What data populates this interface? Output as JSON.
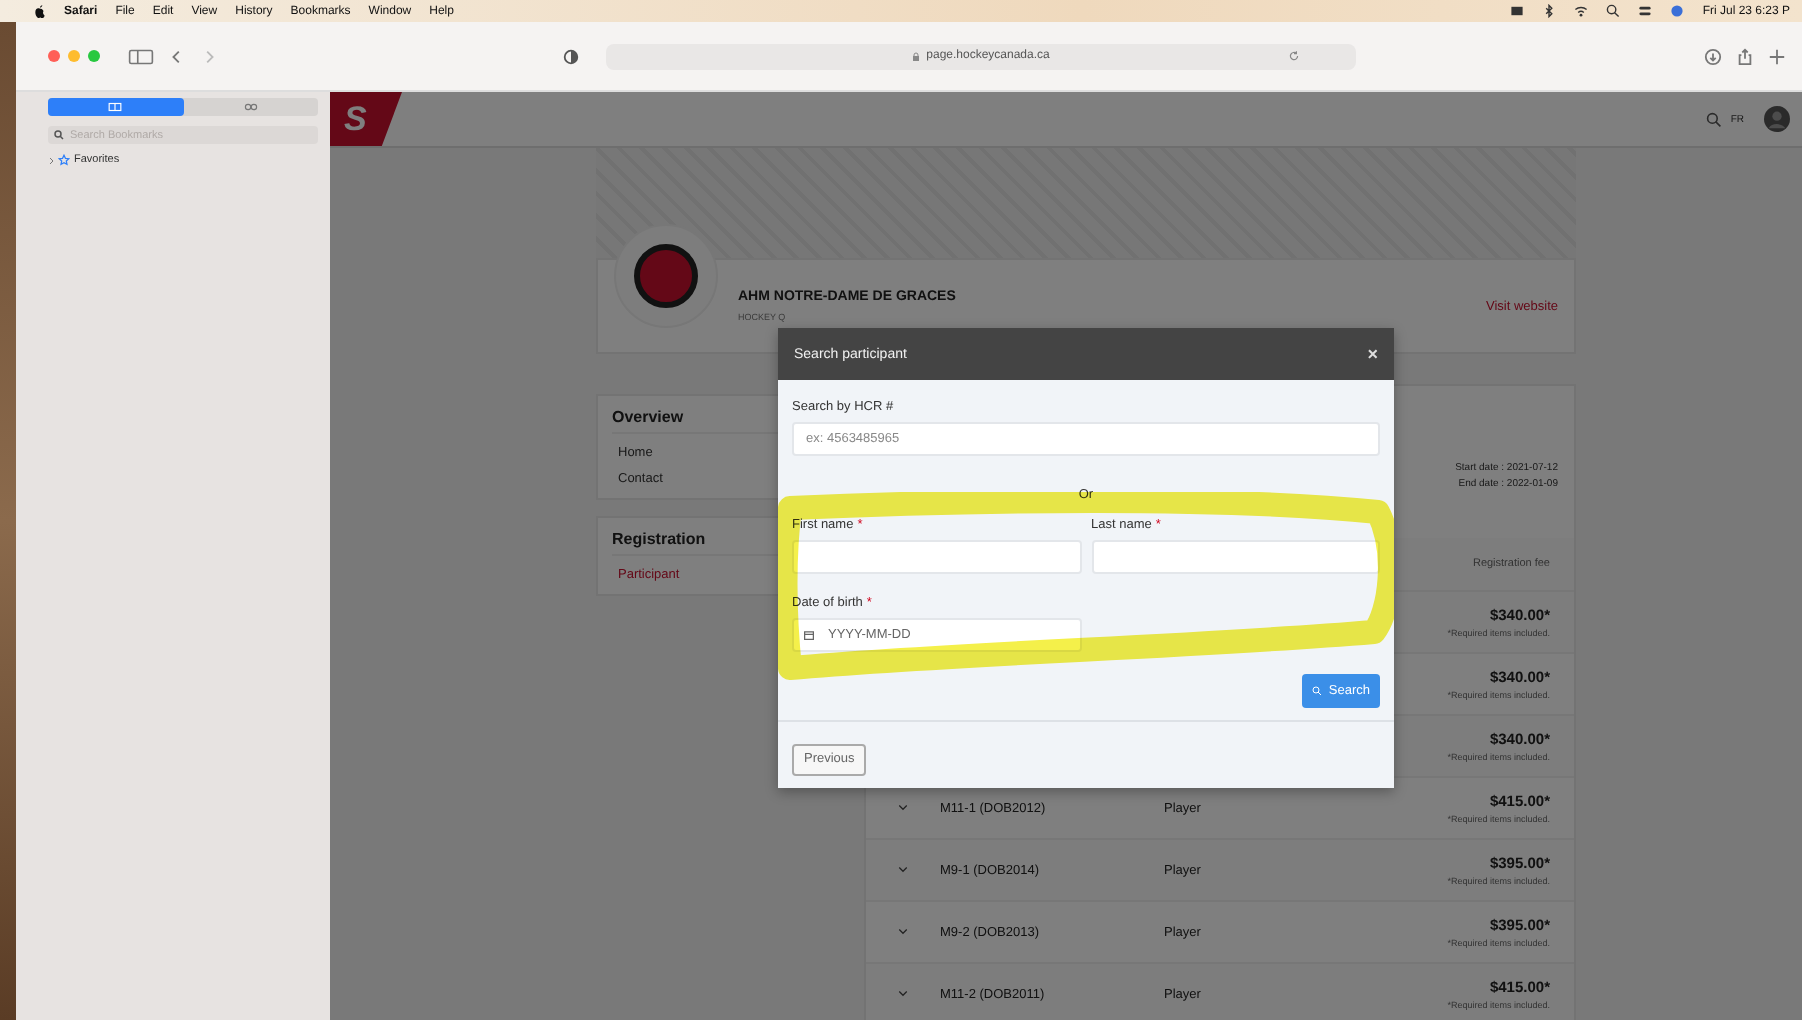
{
  "menu_bar": {
    "app": "Safari",
    "items": [
      "File",
      "Edit",
      "View",
      "History",
      "Bookmarks",
      "Window",
      "Help"
    ],
    "clock": "Fri Jul 23 6:23 P"
  },
  "browser": {
    "url": "page.hockeycanada.ca"
  },
  "sidebar": {
    "segments": [
      {
        "kind": "bookmarks",
        "selected": true
      },
      {
        "kind": "reading-list",
        "selected": false
      }
    ],
    "search": {
      "placeholder": "Search Bookmarks"
    },
    "items": [
      {
        "label": "Favorites",
        "expanded": false
      }
    ]
  },
  "site_header": {
    "logo": "S",
    "language": "FR"
  },
  "club": {
    "name": "AHM NOTRE-DAME DE GRACES",
    "federation": "HOCKEY Q",
    "link": "Visit website"
  },
  "nav_cards": [
    {
      "title": "Overview",
      "items": [
        {
          "label": "Home",
          "selected": false
        },
        {
          "label": "Contact",
          "selected": false
        }
      ]
    },
    {
      "title": "Registration",
      "items": [
        {
          "label": "Participant",
          "selected": true
        }
      ]
    }
  ],
  "season": {
    "start": "Start date : 2021-07-12",
    "end": "End date : 2022-01-09"
  },
  "table": {
    "fee_header": "Registration fee",
    "rows": [
      {
        "fee": "$340.00*",
        "note": "*Required items included."
      },
      {
        "fee": "$340.00*",
        "note": "*Required items included."
      },
      {
        "fee": "$340.00*",
        "note": "*Required items included."
      },
      {
        "name": "M11-1 (DOB2012)",
        "role": "Player",
        "fee": "$415.00*",
        "note": "*Required items included."
      },
      {
        "name": "M9-1 (DOB2014)",
        "role": "Player",
        "fee": "$395.00*",
        "note": "*Required items included."
      },
      {
        "name": "M9-2 (DOB2013)",
        "role": "Player",
        "fee": "$395.00*",
        "note": "*Required items included."
      },
      {
        "name": "M11-2 (DOB2011)",
        "role": "Player",
        "fee": "$415.00*",
        "note": "*Required items included."
      }
    ]
  },
  "modal": {
    "title": "Search participant",
    "close": "×",
    "hcr": {
      "label": "Search by HCR #",
      "placeholder": "ex: 4563485965"
    },
    "separator": "Or",
    "fields": [
      {
        "label": "First name",
        "required_mark": "*",
        "kind": "text"
      },
      {
        "label": "Last name",
        "required_mark": "*",
        "kind": "text"
      },
      {
        "label": "Date of birth",
        "required_mark": "*",
        "kind": "date",
        "placeholder": "YYYY-MM-DD"
      }
    ],
    "search_button": "Search",
    "previous_button": "Previous"
  }
}
